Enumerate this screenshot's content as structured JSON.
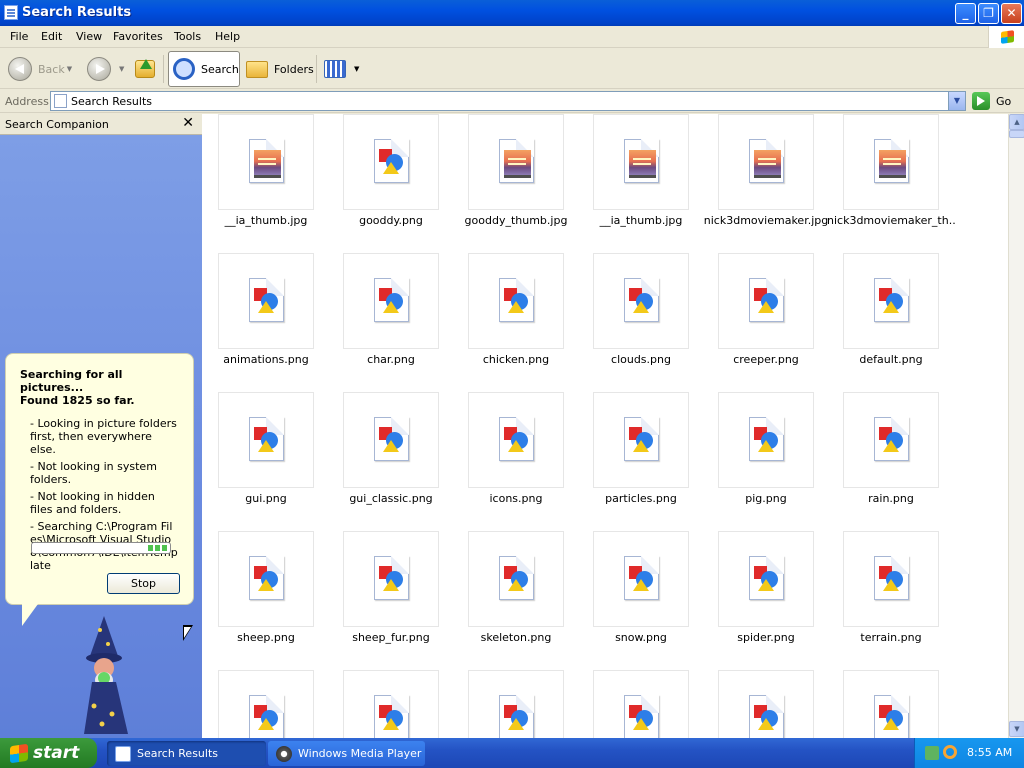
{
  "window": {
    "title": "Search Results"
  },
  "menu": [
    "File",
    "Edit",
    "View",
    "Favorites",
    "Tools",
    "Help"
  ],
  "toolbar": {
    "back": "Back",
    "search": "Search",
    "folders": "Folders"
  },
  "address": {
    "label": "Address",
    "value": "Search Results",
    "go": "Go"
  },
  "search_companion": {
    "title": "Search Companion",
    "status_line1": "Searching for all pictures...",
    "status_line2": "Found 1825 so far.",
    "notes": [
      "- Looking in picture folders first, then everywhere else.",
      "- Not looking in system folders.",
      "- Not looking in hidden files and folders.",
      "- Searching C:\\Program Files\\Microsoft Visual Studio 8\\Common7\\IDE\\ItemTemplate"
    ],
    "stop": "Stop"
  },
  "files": [
    {
      "name": "__ia_thumb.jpg",
      "type": "jpg"
    },
    {
      "name": "gooddy.png",
      "type": "png"
    },
    {
      "name": "gooddy_thumb.jpg",
      "type": "jpg"
    },
    {
      "name": "__ia_thumb.jpg",
      "type": "jpg"
    },
    {
      "name": "nick3dmoviemaker.jpg",
      "type": "jpg"
    },
    {
      "name": "nick3dmoviemaker_th...",
      "type": "jpg"
    },
    {
      "name": "animations.png",
      "type": "png"
    },
    {
      "name": "char.png",
      "type": "png"
    },
    {
      "name": "chicken.png",
      "type": "png"
    },
    {
      "name": "clouds.png",
      "type": "png"
    },
    {
      "name": "creeper.png",
      "type": "png"
    },
    {
      "name": "default.png",
      "type": "png"
    },
    {
      "name": "gui.png",
      "type": "png"
    },
    {
      "name": "gui_classic.png",
      "type": "png"
    },
    {
      "name": "icons.png",
      "type": "png"
    },
    {
      "name": "particles.png",
      "type": "png"
    },
    {
      "name": "pig.png",
      "type": "png"
    },
    {
      "name": "rain.png",
      "type": "png"
    },
    {
      "name": "sheep.png",
      "type": "png"
    },
    {
      "name": "sheep_fur.png",
      "type": "png"
    },
    {
      "name": "skeleton.png",
      "type": "png"
    },
    {
      "name": "snow.png",
      "type": "png"
    },
    {
      "name": "spider.png",
      "type": "png"
    },
    {
      "name": "terrain.png",
      "type": "png"
    },
    {
      "name": "",
      "type": "png"
    },
    {
      "name": "",
      "type": "png"
    },
    {
      "name": "",
      "type": "png"
    },
    {
      "name": "",
      "type": "png"
    },
    {
      "name": "",
      "type": "png"
    },
    {
      "name": "",
      "type": "png"
    }
  ],
  "taskbar": {
    "start": "start",
    "tasks": [
      "Search Results",
      "Windows Media Player"
    ],
    "clock": "8:55 AM"
  }
}
